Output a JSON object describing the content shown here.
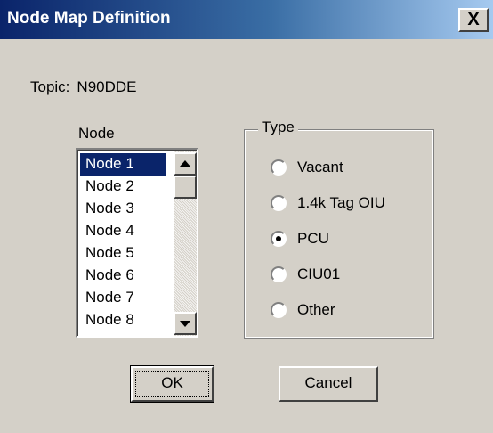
{
  "window": {
    "title": "Node Map Definition",
    "close_glyph": "X"
  },
  "topic": {
    "label": "Topic:",
    "value": "N90DDE"
  },
  "node_list": {
    "label": "Node",
    "selected_index": 0,
    "items": [
      "Node 1",
      "Node 2",
      "Node 3",
      "Node 4",
      "Node 5",
      "Node 6",
      "Node 7",
      "Node 8"
    ]
  },
  "type_group": {
    "label": "Type",
    "selected_index": 2,
    "options": [
      "Vacant",
      "1.4k Tag OIU",
      "PCU",
      "CIU01",
      "Other"
    ]
  },
  "buttons": {
    "ok_label": "OK",
    "cancel_label": "Cancel"
  },
  "icons": {
    "close": "close-icon",
    "scroll_up": "arrow-up-icon",
    "scroll_down": "arrow-down-icon"
  },
  "colors": {
    "title_bar_start": "#0a246a",
    "title_bar_end": "#a6caf0",
    "face": "#d4d0c8",
    "selection": "#0a246a"
  }
}
